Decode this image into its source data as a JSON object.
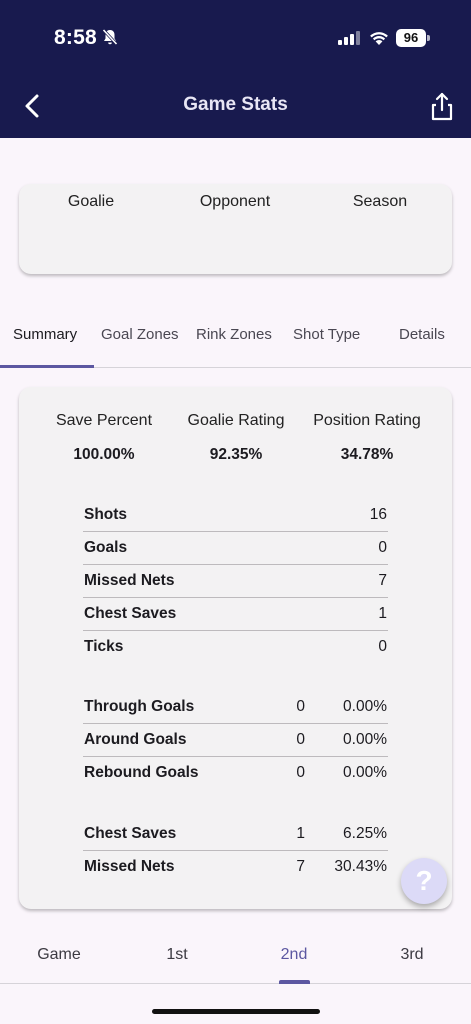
{
  "status": {
    "time": "8:58",
    "battery": "96"
  },
  "header": {
    "title": "Game Stats"
  },
  "filters": [
    "Goalie",
    "Opponent",
    "Season"
  ],
  "tabs": [
    "Summary",
    "Goal Zones",
    "Rink Zones",
    "Shot Type",
    "Details"
  ],
  "active_tab": "Summary",
  "metrics": [
    {
      "label": "Save Percent",
      "value": "100.00%"
    },
    {
      "label": "Goalie Rating",
      "value": "92.35%"
    },
    {
      "label": "Position Rating",
      "value": "34.78%"
    }
  ],
  "counts": [
    {
      "label": "Shots",
      "value": "16"
    },
    {
      "label": "Goals",
      "value": "0"
    },
    {
      "label": "Missed Nets",
      "value": "7"
    },
    {
      "label": "Chest Saves",
      "value": "1"
    },
    {
      "label": "Ticks",
      "value": "0"
    }
  ],
  "goal_types": [
    {
      "label": "Through Goals",
      "count": "0",
      "pct": "0.00%"
    },
    {
      "label": "Around Goals",
      "count": "0",
      "pct": "0.00%"
    },
    {
      "label": "Rebound Goals",
      "count": "0",
      "pct": "0.00%"
    }
  ],
  "save_types": [
    {
      "label": "Chest Saves",
      "count": "1",
      "pct": "6.25%"
    },
    {
      "label": "Missed Nets",
      "count": "7",
      "pct": "30.43%"
    }
  ],
  "help": {
    "label": "?"
  },
  "periods": [
    "Game",
    "1st",
    "2nd",
    "3rd"
  ],
  "active_period": "2nd",
  "colors": {
    "header_bg": "#181a4e",
    "accent": "#5c57a1",
    "card_bg": "#f3f2f3",
    "page_bg": "#faf5fb"
  }
}
